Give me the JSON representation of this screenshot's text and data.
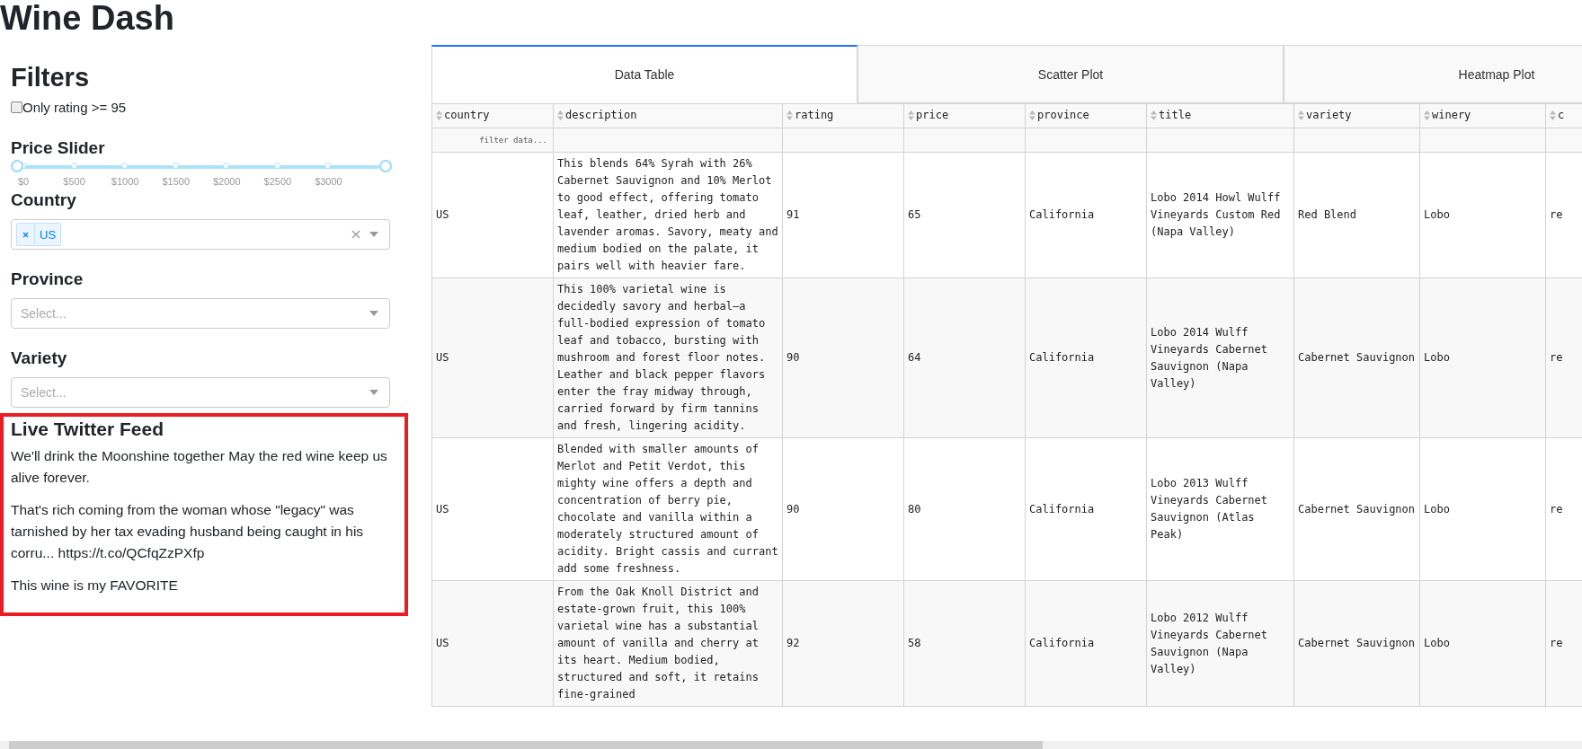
{
  "page_title": "Wine Dash",
  "filters": {
    "heading": "Filters",
    "rating_checkbox": {
      "label": "Only rating >= 95",
      "checked": false
    },
    "price_slider": {
      "label": "Price Slider",
      "level": 1,
      "marks": [
        "$0",
        "$500",
        "$1000",
        "$1500",
        "$2000",
        "$2500",
        "$3000"
      ]
    },
    "country": {
      "label": "Country",
      "tags": [
        "US"
      ]
    },
    "province": {
      "label": "Province",
      "placeholder": "Select..."
    },
    "variety": {
      "label": "Variety",
      "placeholder": "Select..."
    }
  },
  "twitter_feed": {
    "heading": "Live Twitter Feed",
    "tweets": [
      "We'll drink the Moonshine together May the red wine keep us alive forever.",
      "That's rich coming from the woman whose \"legacy\" was tarnished by her tax evading husband being caught in his corru... https://t.co/QCfqZzPXfp",
      "This wine is my FAVORITE"
    ]
  },
  "tabs": [
    {
      "label": "Data Table",
      "selected": true
    },
    {
      "label": "Scatter Plot",
      "selected": false
    },
    {
      "label": "Heatmap Plot",
      "selected": false
    }
  ],
  "table": {
    "columns": [
      "country",
      "description",
      "rating",
      "price",
      "province",
      "title",
      "variety",
      "winery",
      "c"
    ],
    "filter_placeholder": "filter data...",
    "rows": [
      [
        "US",
        "This blends 64% Syrah with 26% Cabernet Sauvignon and 10% Merlot to good effect, offering tomato leaf, leather, dried herb and lavender aromas. Savory, meaty and medium bodied on the palate, it pairs well with heavier fare.",
        "91",
        "65",
        "California",
        "Lobo 2014 Howl Wulff Vineyards Custom Red (Napa Valley)",
        "Red Blend",
        "Lobo",
        "re"
      ],
      [
        "US",
        "This 100% varietal wine is decidedly savory and herbal—a full-bodied expression of tomato leaf and tobacco, bursting with mushroom and forest floor notes. Leather and black pepper flavors enter the fray midway through, carried forward by firm tannins and fresh, lingering acidity.",
        "90",
        "64",
        "California",
        "Lobo 2014 Wulff Vineyards Cabernet Sauvignon (Napa Valley)",
        "Cabernet Sauvignon",
        "Lobo",
        "re"
      ],
      [
        "US",
        "Blended with smaller amounts of Merlot and Petit Verdot, this mighty wine offers a depth and concentration of berry pie, chocolate and vanilla within a moderately structured amount of acidity. Bright cassis and currant add some freshness.",
        "90",
        "80",
        "California",
        "Lobo 2013 Wulff Vineyards Cabernet Sauvignon (Atlas Peak)",
        "Cabernet Sauvignon",
        "Lobo",
        "re"
      ],
      [
        "US",
        "From the Oak Knoll District and estate-grown fruit, this 100% varietal wine has a substantial amount of vanilla and cherry at its heart. Medium bodied, structured and soft, it retains fine-grained",
        "92",
        "58",
        "California",
        "Lobo 2012 Wulff Vineyards Cabernet Sauvignon (Napa Valley)",
        "Cabernet Sauvignon",
        "Lobo",
        "re"
      ]
    ]
  }
}
